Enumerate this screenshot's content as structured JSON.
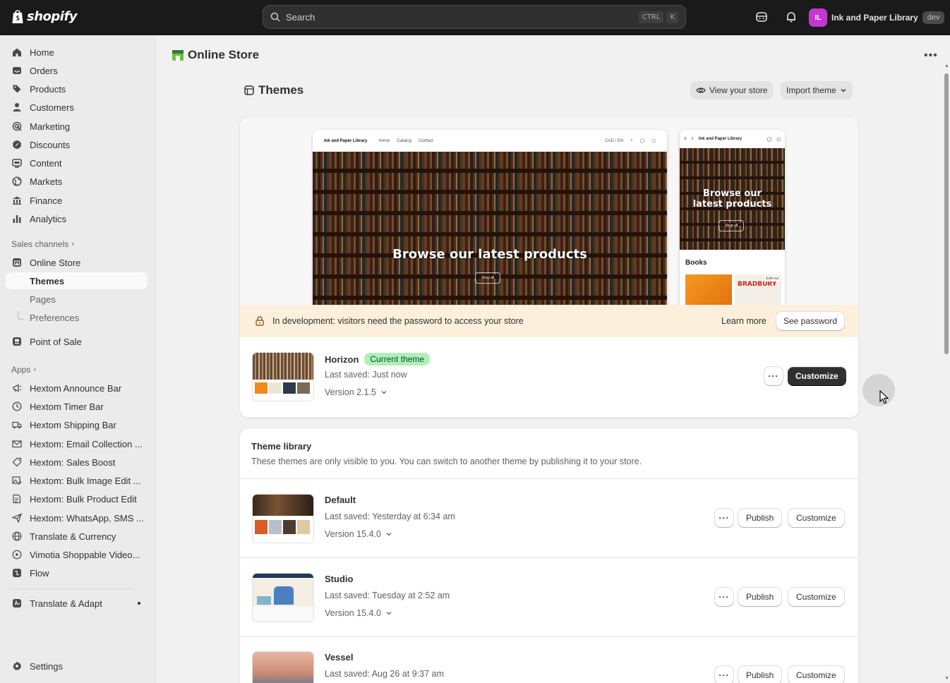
{
  "topbar": {
    "logo_text": "shopify",
    "search_placeholder": "Search",
    "kbd_ctrl": "CTRL",
    "kbd_k": "K",
    "store_initials": "IL",
    "store_name": "Ink and Paper Library",
    "store_badge": "dev"
  },
  "sidebar": {
    "main_items": [
      {
        "label": "Home",
        "icon": "home-icon"
      },
      {
        "label": "Orders",
        "icon": "inbox-icon"
      },
      {
        "label": "Products",
        "icon": "tag-icon"
      },
      {
        "label": "Customers",
        "icon": "person-icon"
      },
      {
        "label": "Marketing",
        "icon": "target-icon"
      },
      {
        "label": "Discounts",
        "icon": "discount-icon"
      },
      {
        "label": "Content",
        "icon": "content-icon"
      },
      {
        "label": "Markets",
        "icon": "globe-icon"
      },
      {
        "label": "Finance",
        "icon": "bank-icon"
      },
      {
        "label": "Analytics",
        "icon": "chart-icon"
      }
    ],
    "sales_channels_label": "Sales channels",
    "online_store": "Online Store",
    "themes": "Themes",
    "pages": "Pages",
    "preferences": "Preferences",
    "point_of_sale": "Point of Sale",
    "apps_label": "Apps",
    "apps": [
      "Hextom Announce Bar",
      "Hextom Timer Bar",
      "Hextom Shipping Bar",
      "Hextom: Email Collection ...",
      "Hextom: Sales Boost",
      "Hextom: Bulk Image Edit ...",
      "Hextom: Bulk Product Edit",
      "Hextom: WhatsApp, SMS ...",
      "Translate & Currency",
      "Vimotia Shoppable Video...",
      "Flow"
    ],
    "translate_adapt": "Translate & Adapt",
    "settings": "Settings"
  },
  "header": {
    "title": "Online Store",
    "themes_title": "Themes",
    "view_store": "View your store",
    "import_theme": "Import theme"
  },
  "preview": {
    "store_name": "Ink and Paper Library",
    "nav_links": [
      "Home",
      "Catalog",
      "Contact"
    ],
    "currency": "CAD / EN",
    "hero": "Browse our latest products",
    "mobile_hero": "Browse our latest products",
    "shop_all": "Shop all",
    "books": "Books",
    "book_author": "BRADBURY",
    "sold_out": "Sold out"
  },
  "banner": {
    "message": "In development: visitors need the password to access your store",
    "learn_more": "Learn more",
    "see_password": "See password"
  },
  "current_theme": {
    "name": "Horizon",
    "badge": "Current theme",
    "saved": "Last saved: Just now",
    "version": "Version 2.1.5",
    "customize": "Customize"
  },
  "library": {
    "title": "Theme library",
    "description": "These themes are only visible to you. You can switch to another theme by publishing it to your store.",
    "publish_label": "Publish",
    "customize_label": "Customize",
    "themes": [
      {
        "name": "Default",
        "saved": "Last saved: Yesterday at 6:34 am",
        "version": "Version 15.4.0"
      },
      {
        "name": "Studio",
        "saved": "Last saved: Tuesday at 2:52 am",
        "version": "Version 15.4.0"
      },
      {
        "name": "Vessel",
        "saved": "Last saved: Aug 26 at 9:37 am",
        "version": ""
      }
    ]
  }
}
